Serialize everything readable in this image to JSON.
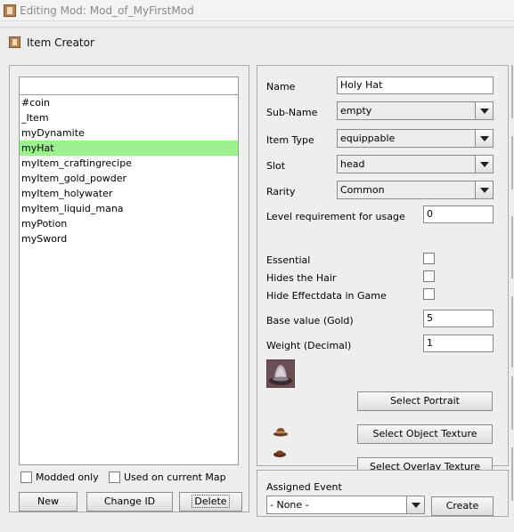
{
  "window": {
    "title": "Editing Mod: Mod_of_MyFirstMod"
  },
  "dialog": {
    "title": "Item Creator"
  },
  "item_list": {
    "search_value": "",
    "items": [
      {
        "label": "#coin",
        "selected": false
      },
      {
        "label": "_Item",
        "selected": false
      },
      {
        "label": "myDynamite",
        "selected": false
      },
      {
        "label": "myHat",
        "selected": true
      },
      {
        "label": "myItem_craftingrecipe",
        "selected": false
      },
      {
        "label": "myItem_gold_powder",
        "selected": false
      },
      {
        "label": "myItem_holywater",
        "selected": false
      },
      {
        "label": "myItem_liquid_mana",
        "selected": false
      },
      {
        "label": "myPotion",
        "selected": false
      },
      {
        "label": "mySword",
        "selected": false
      }
    ],
    "selected_color": "#9cf08e"
  },
  "filters": {
    "modded_only_label": "Modded only",
    "used_on_map_label": "Used on current Map"
  },
  "list_buttons": {
    "new_label": "New",
    "change_id_label": "Change ID",
    "delete_label": "Delete"
  },
  "properties": {
    "name_label": "Name",
    "name_value": "Holy Hat",
    "subname_label": "Sub-Name",
    "subname_value": "empty",
    "item_type_label": "Item Type",
    "item_type_value": "equippable",
    "slot_label": "Slot",
    "slot_value": "head",
    "rarity_label": "Rarity",
    "rarity_value": "Common",
    "level_req_label": "Level requirement for usage",
    "level_req_value": "0",
    "essential_label": "Essential",
    "hides_hair_label": "Hides the Hair",
    "hide_effect_label": "Hide Effectdata in Game",
    "base_value_label": "Base value (Gold)",
    "base_value": "5",
    "weight_label": "Weight (Decimal)",
    "weight_value": "1"
  },
  "texture_buttons": {
    "portrait_label": "Select Portrait",
    "object_label": "Select Object Texture",
    "overlay_label": "Select Overlay Texture"
  },
  "event": {
    "label": "Assigned Event",
    "value": "- None -",
    "create_label": "Create"
  }
}
